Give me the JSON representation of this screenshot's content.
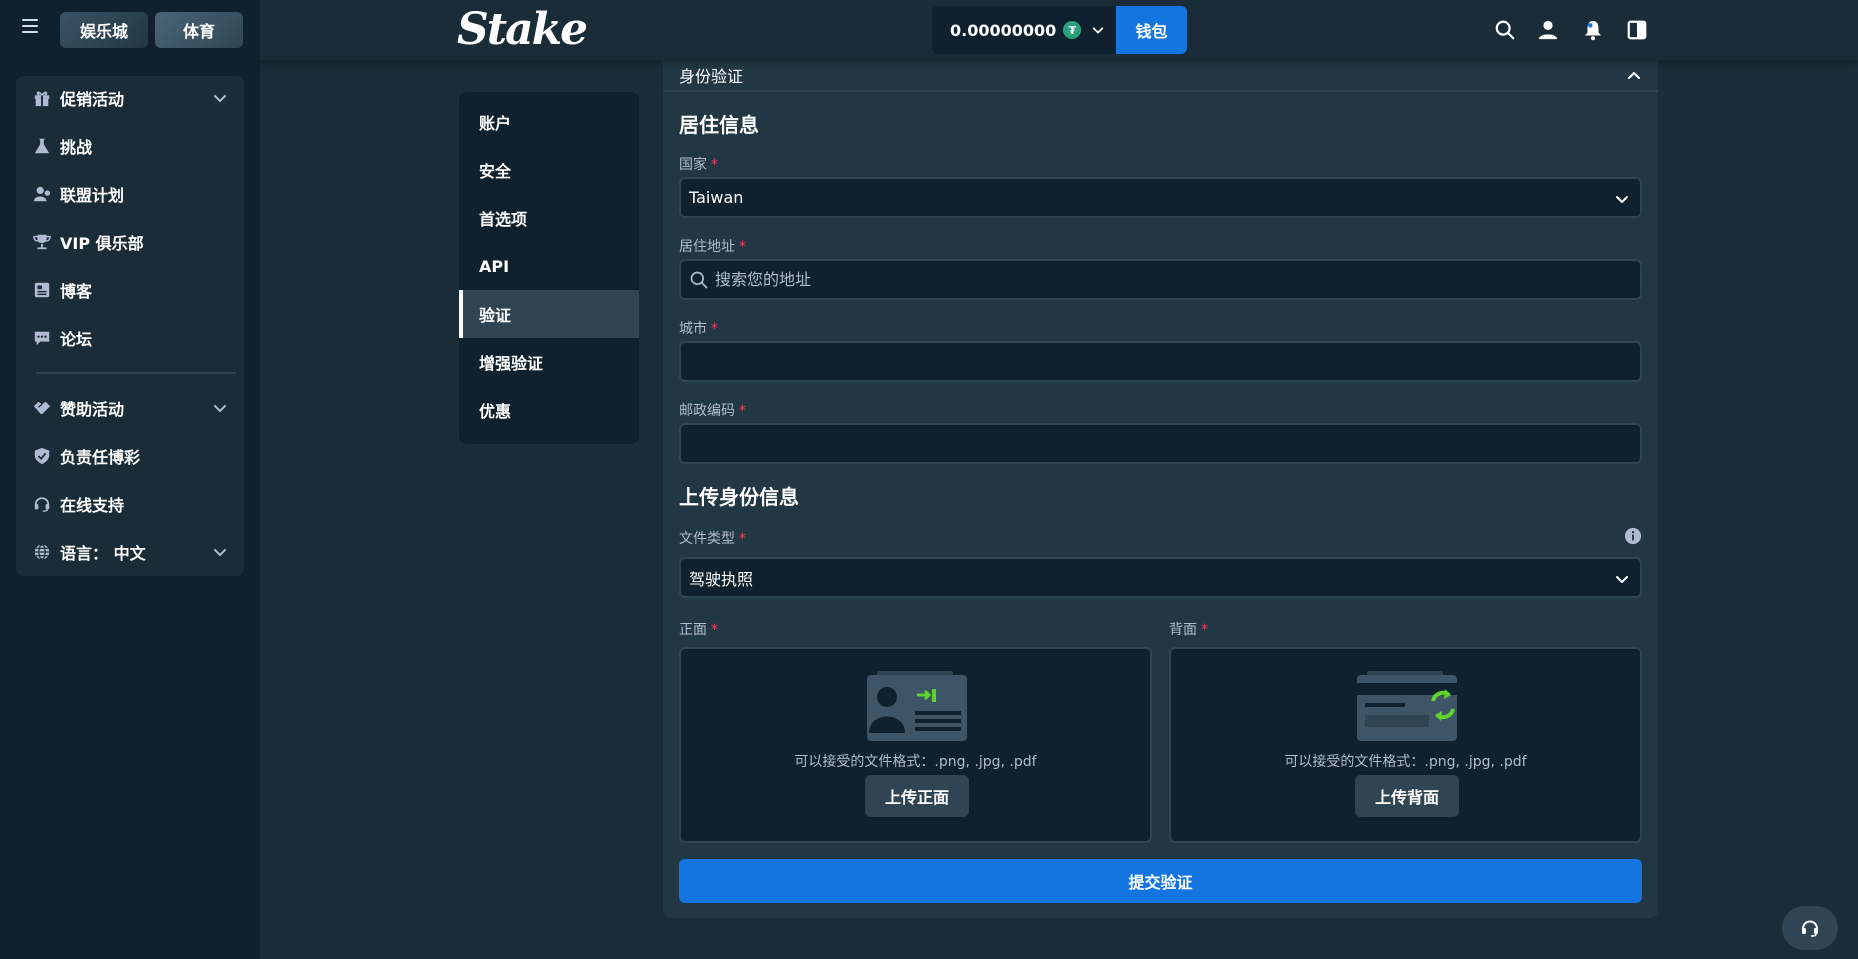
{
  "header": {
    "casino_label": "娱乐城",
    "sports_label": "体育",
    "logo": "Stake",
    "balance": "0.00000000",
    "currency_icon": "tether-icon",
    "wallet_label": "钱包"
  },
  "sidebar": {
    "items": [
      {
        "label": "促销活动",
        "icon": "gift-icon",
        "has_chevron": true
      },
      {
        "label": "挑战",
        "icon": "flask-icon",
        "has_chevron": false
      },
      {
        "label": "联盟计划",
        "icon": "affiliate-icon",
        "has_chevron": false
      },
      {
        "label": "VIP 俱乐部",
        "icon": "trophy-icon",
        "has_chevron": false
      },
      {
        "label": "博客",
        "icon": "blog-icon",
        "has_chevron": false
      },
      {
        "label": "论坛",
        "icon": "chat-icon",
        "has_chevron": false
      },
      {
        "label": "赞助活动",
        "icon": "handshake-icon",
        "has_chevron": true
      },
      {
        "label": "负责任博彩",
        "icon": "shield-icon",
        "has_chevron": false
      },
      {
        "label": "在线支持",
        "icon": "headset-icon",
        "has_chevron": false
      },
      {
        "label": "语言： 中文",
        "icon": "globe-icon",
        "has_chevron": true
      }
    ]
  },
  "settings_nav": {
    "items": [
      "账户",
      "安全",
      "首选项",
      "API",
      "验证",
      "增强验证",
      "优惠"
    ],
    "active": "验证"
  },
  "panel": {
    "header": "身份验证",
    "residence_title": "居住信息",
    "country_label": "国家",
    "country_value": "Taiwan",
    "address_label": "居住地址",
    "address_placeholder": "搜索您的地址",
    "city_label": "城市",
    "city_value": "",
    "postal_label": "邮政编码",
    "postal_value": "",
    "upload_title": "上传身份信息",
    "doctype_label": "文件类型",
    "doctype_value": "驾驶执照",
    "front_label": "正面",
    "back_label": "背面",
    "accepted_formats": "可以接受的文件格式：.png, .jpg, .pdf",
    "upload_front": "上传正面",
    "upload_back": "上传背面",
    "submit": "提交验证",
    "required_mark": "*"
  },
  "colors": {
    "accent": "#1475e1",
    "required": "#ed4163",
    "bg": "#1a2c38",
    "panel": "#213743",
    "field": "#0f212e",
    "muted_text": "#b1bad3"
  }
}
